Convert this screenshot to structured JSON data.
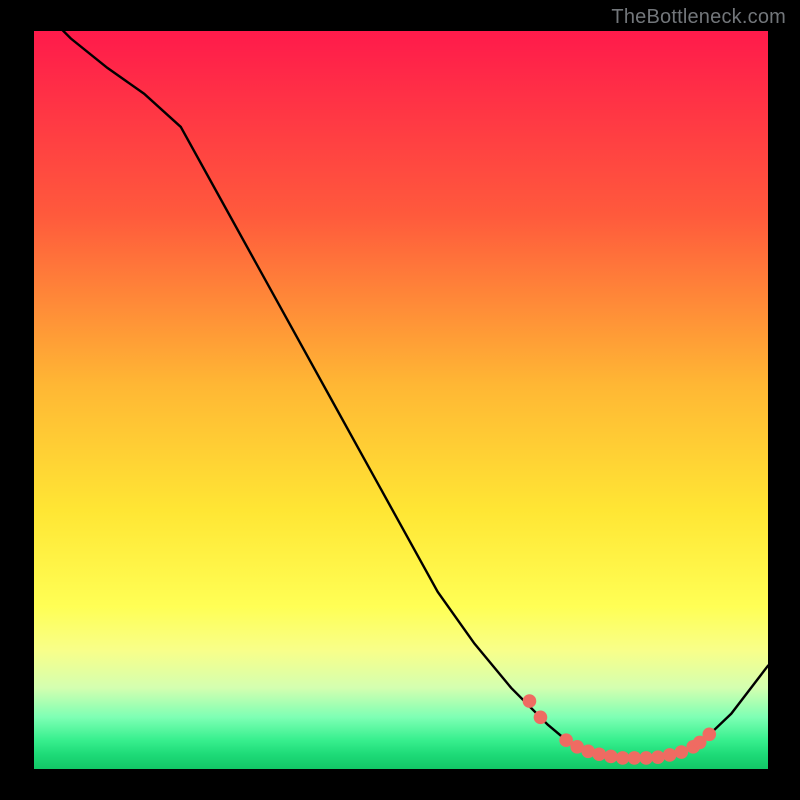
{
  "watermark": "TheBottleneck.com",
  "chart_data": {
    "type": "line",
    "title": "",
    "xlabel": "",
    "ylabel": "",
    "xlim": [
      0,
      100
    ],
    "ylim": [
      0,
      100
    ],
    "series": [
      {
        "name": "curve",
        "x": [
          0,
          5,
          10,
          15,
          20,
          25,
          30,
          35,
          40,
          45,
          50,
          55,
          60,
          65,
          70,
          73,
          76,
          80,
          85,
          88,
          91,
          95,
          100
        ],
        "y": [
          104,
          99,
          95,
          91.5,
          87,
          78,
          69,
          60,
          51,
          42,
          33,
          24,
          17,
          11,
          6,
          3.5,
          2.2,
          1.5,
          1.5,
          2.2,
          3.7,
          7.5,
          14
        ]
      }
    ],
    "markers": {
      "name": "highlight-dots",
      "color": "#ef6b62",
      "points": [
        {
          "x": 67.5,
          "y": 9.2
        },
        {
          "x": 69.0,
          "y": 7.0
        },
        {
          "x": 72.5,
          "y": 3.9
        },
        {
          "x": 74.0,
          "y": 3.0
        },
        {
          "x": 75.5,
          "y": 2.4
        },
        {
          "x": 77.0,
          "y": 2.0
        },
        {
          "x": 78.6,
          "y": 1.7
        },
        {
          "x": 80.2,
          "y": 1.5
        },
        {
          "x": 81.8,
          "y": 1.5
        },
        {
          "x": 83.4,
          "y": 1.5
        },
        {
          "x": 85.0,
          "y": 1.6
        },
        {
          "x": 86.6,
          "y": 1.9
        },
        {
          "x": 88.2,
          "y": 2.3
        },
        {
          "x": 89.8,
          "y": 3.0
        },
        {
          "x": 90.7,
          "y": 3.6
        },
        {
          "x": 92.0,
          "y": 4.7
        }
      ]
    },
    "gradient_stops": [
      {
        "pos": 0.0,
        "color": "#ff1a4b"
      },
      {
        "pos": 0.25,
        "color": "#ff5a3c"
      },
      {
        "pos": 0.48,
        "color": "#ffb734"
      },
      {
        "pos": 0.65,
        "color": "#ffe634"
      },
      {
        "pos": 0.78,
        "color": "#ffff55"
      },
      {
        "pos": 0.89,
        "color": "#d4ffb0"
      },
      {
        "pos": 0.96,
        "color": "#39f08f"
      },
      {
        "pos": 1.0,
        "color": "#12c766"
      }
    ]
  }
}
